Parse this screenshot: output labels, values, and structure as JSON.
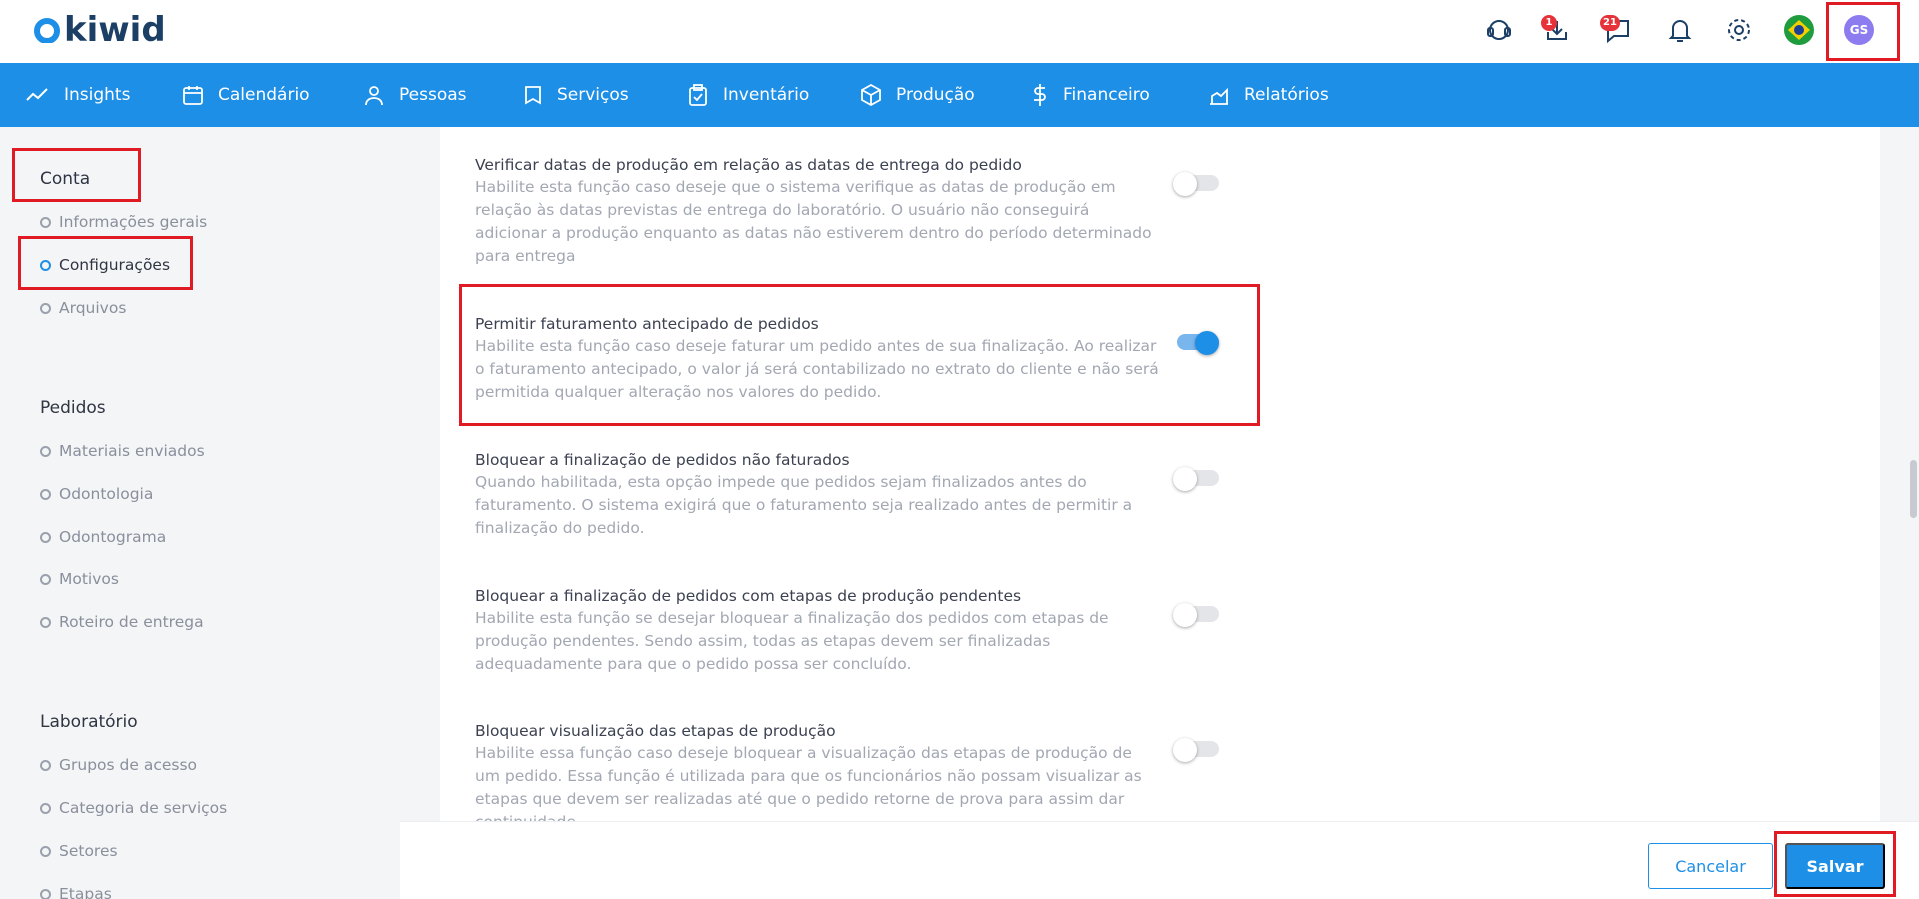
{
  "brand": {
    "logo_text": "kiwid"
  },
  "header": {
    "download_badge": "1",
    "messages_badge": "21",
    "avatar_initials": "GS"
  },
  "nav": {
    "items": [
      {
        "label": "Insights",
        "icon": "trend-line-icon"
      },
      {
        "label": "Calendário",
        "icon": "calendar-icon"
      },
      {
        "label": "Pessoas",
        "icon": "person-icon"
      },
      {
        "label": "Serviços",
        "icon": "tooth-icon"
      },
      {
        "label": "Inventário",
        "icon": "clipboard-icon"
      },
      {
        "label": "Produção",
        "icon": "box-icon"
      },
      {
        "label": "Financeiro",
        "icon": "dollar-icon"
      },
      {
        "label": "Relatórios",
        "icon": "chart-icon"
      }
    ]
  },
  "sidebar": {
    "sections": [
      {
        "title": "Conta",
        "items": [
          "Informações gerais",
          "Configurações",
          "Arquivos"
        ]
      },
      {
        "title": "Pedidos",
        "items": [
          "Materiais enviados",
          "Odontologia",
          "Odontograma",
          "Motivos",
          "Roteiro de entrega"
        ]
      },
      {
        "title": "Laboratório",
        "items": [
          "Grupos de acesso",
          "Categoria de serviços",
          "Setores",
          "Etapas"
        ]
      }
    ],
    "active_item": "Configurações"
  },
  "settings": [
    {
      "title": "Verificar datas de produção em relação as datas de entrega do pedido",
      "desc": [
        "Habilite esta função caso deseje que o sistema verifique as datas de produção em",
        "relação às datas previstas de entrega do laboratório. O usuário não conseguirá",
        "adicionar a produção enquanto as datas não estiverem dentro do período determinado",
        "para entrega"
      ],
      "enabled": false
    },
    {
      "title": "Permitir faturamento antecipado de pedidos",
      "desc": [
        "Habilite esta função caso deseje faturar um pedido antes de sua finalização. Ao realizar",
        "o faturamento antecipado, o valor já será contabilizado no extrato do cliente e não será",
        "permitida qualquer alteração nos valores do pedido."
      ],
      "enabled": true
    },
    {
      "title": "Bloquear a finalização de pedidos não faturados",
      "desc": [
        "Quando habilitada, esta opção impede que pedidos sejam finalizados antes do",
        "faturamento. O sistema exigirá que o faturamento seja realizado antes de permitir a",
        "finalização do pedido."
      ],
      "enabled": false
    },
    {
      "title": "Bloquear a finalização de pedidos com etapas de produção pendentes",
      "desc": [
        "Habilite esta função se desejar bloquear a finalização dos pedidos com etapas de",
        "produção pendentes. Sendo assim, todas as etapas devem ser finalizadas",
        "adequadamente para que o pedido possa ser concluído."
      ],
      "enabled": false
    },
    {
      "title": "Bloquear visualização das etapas de produção",
      "desc": [
        "Habilite essa função caso deseje bloquear a visualização das etapas de produção de",
        "um pedido. Essa função é utilizada para que os funcionários não possam visualizar as",
        "etapas que devem ser realizadas até que o pedido retorne de prova para assim dar",
        "continuidade"
      ],
      "enabled": false
    }
  ],
  "footer": {
    "cancel_label": "Cancelar",
    "save_label": "Salvar"
  },
  "colors": {
    "primary": "#1e8fe6",
    "highlight": "#e01b24",
    "badge": "#e6333a"
  }
}
